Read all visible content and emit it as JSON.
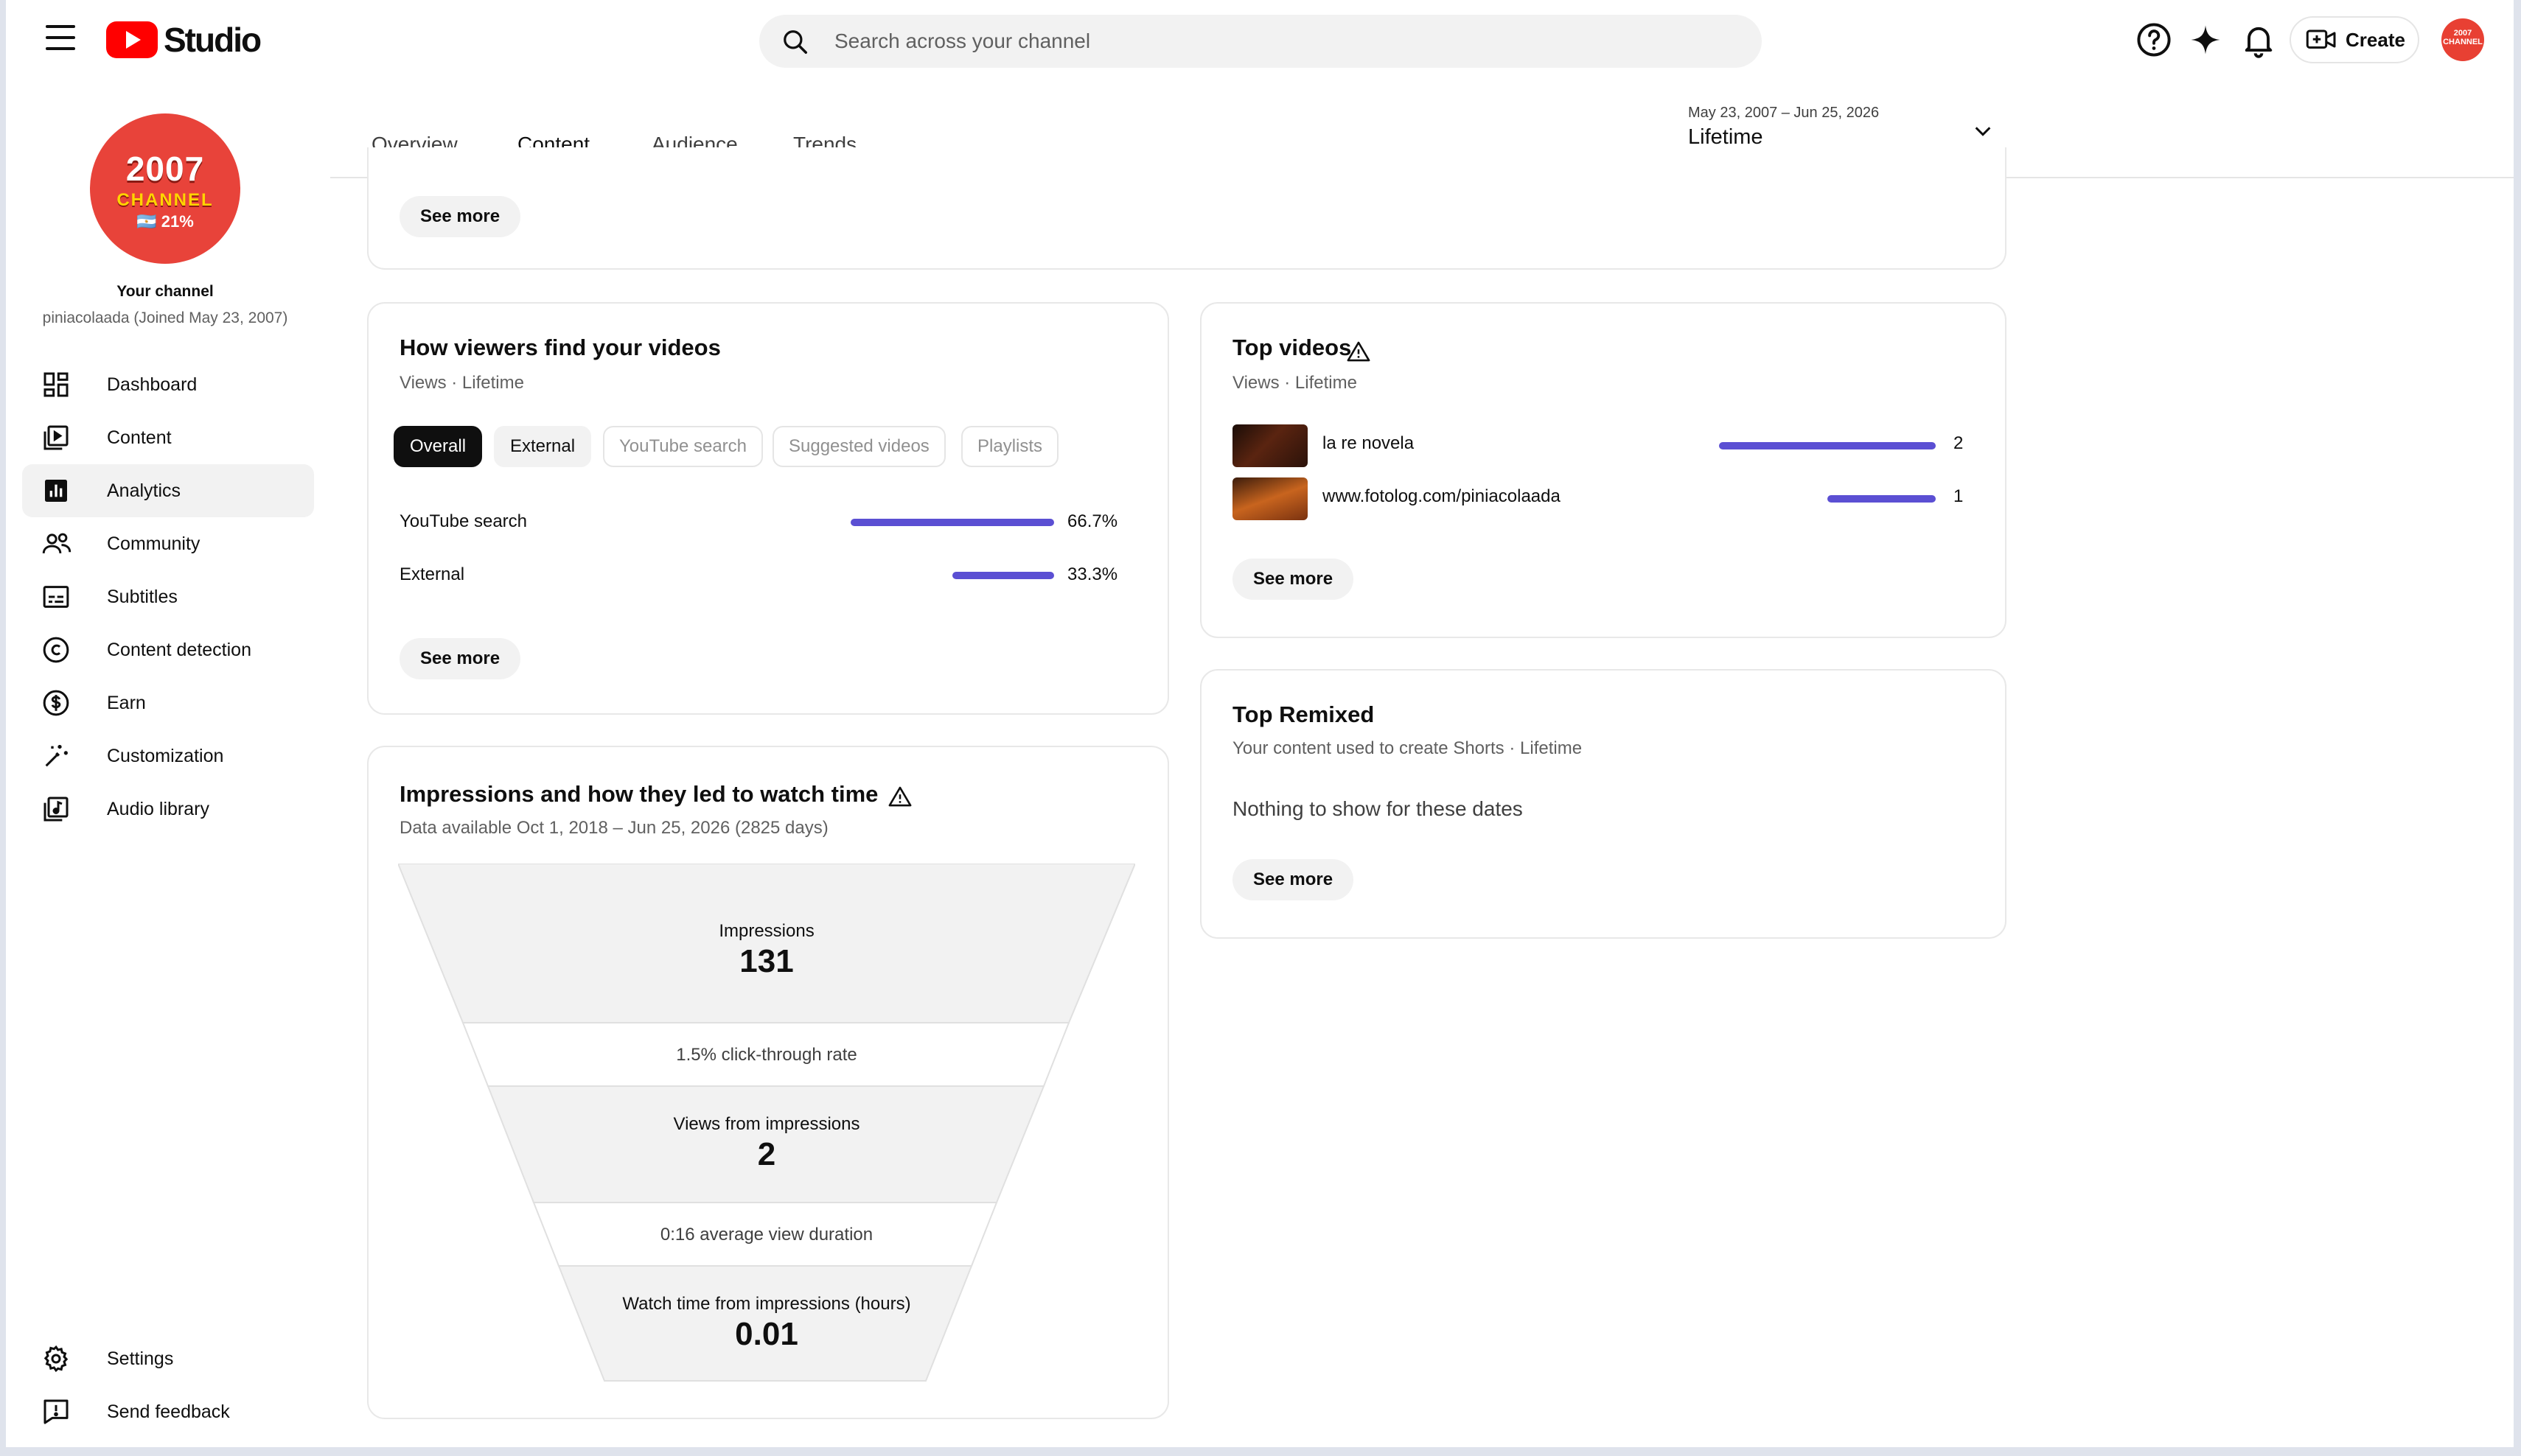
{
  "header": {
    "brand": "Studio",
    "search_placeholder": "Search across your channel",
    "create_label": "Create",
    "avatar_text": "2007 CHANNEL"
  },
  "sidebar": {
    "channel_avatar": {
      "year": "2007",
      "word": "CHANNEL",
      "percent": "🇦🇷 21%"
    },
    "channel_title": "Your channel",
    "channel_subtitle": "piniacolaada (Joined May 23, 2007)",
    "items": [
      {
        "label": "Dashboard",
        "icon": "dashboard-icon"
      },
      {
        "label": "Content",
        "icon": "content-icon"
      },
      {
        "label": "Analytics",
        "icon": "analytics-icon",
        "active": true
      },
      {
        "label": "Community",
        "icon": "community-icon"
      },
      {
        "label": "Subtitles",
        "icon": "subtitles-icon"
      },
      {
        "label": "Content detection",
        "icon": "copyright-icon"
      },
      {
        "label": "Earn",
        "icon": "dollar-icon"
      },
      {
        "label": "Customization",
        "icon": "magic-wand-icon"
      },
      {
        "label": "Audio library",
        "icon": "audio-library-icon"
      }
    ],
    "bottom_items": [
      {
        "label": "Settings",
        "icon": "gear-icon"
      },
      {
        "label": "Send feedback",
        "icon": "feedback-icon"
      }
    ]
  },
  "tabs": [
    "Overview",
    "Content",
    "Audience",
    "Trends"
  ],
  "active_tab": "Content",
  "date_picker": {
    "range": "May 23, 2007 – Jun 25, 2026",
    "preset": "Lifetime"
  },
  "see_more": "See more",
  "traffic_card": {
    "title": "How viewers find your videos",
    "subtitle": "Views · Lifetime",
    "chips": [
      {
        "label": "Overall",
        "state": "selected"
      },
      {
        "label": "External",
        "state": "enabled"
      },
      {
        "label": "YouTube search",
        "state": "disabled"
      },
      {
        "label": "Suggested videos",
        "state": "disabled"
      },
      {
        "label": "Playlists",
        "state": "disabled"
      }
    ],
    "rows": [
      {
        "label": "YouTube search",
        "value": "66.7%",
        "fraction": 0.667
      },
      {
        "label": "External",
        "value": "33.3%",
        "fraction": 0.333
      }
    ],
    "bar_color": "#5b4fd3"
  },
  "top_videos_card": {
    "title": "Top videos",
    "subtitle": "Views · Lifetime",
    "rows": [
      {
        "title": "la re novela",
        "views": "2",
        "fraction": 1.0
      },
      {
        "title": "www.fotolog.com/piniacolaada",
        "views": "1",
        "fraction": 0.5
      }
    ]
  },
  "top_remixed_card": {
    "title": "Top Remixed",
    "subtitle": "Your content used to create Shorts · Lifetime",
    "empty_message": "Nothing to show for these dates"
  },
  "impressions_card": {
    "title": "Impressions and how they led to watch time",
    "subtitle": "Data available Oct 1, 2018 – Jun 25, 2026 (2825 days)",
    "impressions_label": "Impressions",
    "impressions_value": "131",
    "ctr_text": "1.5% click-through rate",
    "views_label": "Views from impressions",
    "views_value": "2",
    "avd_text": "0:16 average view duration",
    "watch_label": "Watch time from impressions (hours)",
    "watch_value": "0.01"
  }
}
